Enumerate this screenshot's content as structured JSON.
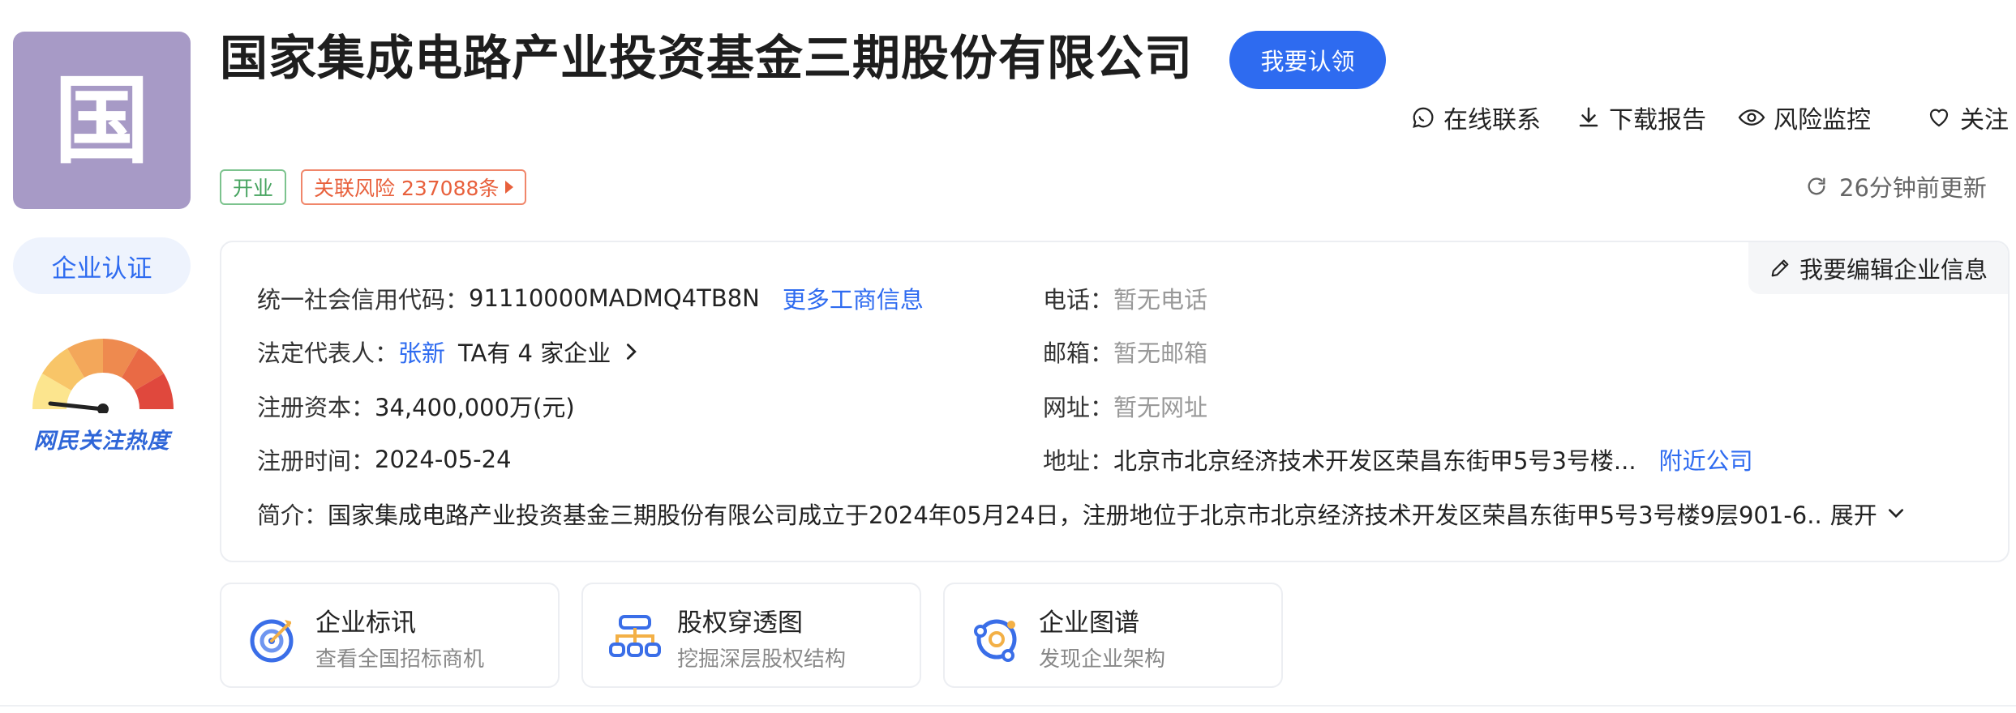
{
  "company": {
    "logo_char": "国",
    "name": "国家集成电路产业投资基金三期股份有限公司",
    "claim_label": "我要认领"
  },
  "actions": {
    "contact": "在线联系",
    "download": "下载报告",
    "monitor": "风险监控",
    "follow": "关注"
  },
  "tags": {
    "status": "开业",
    "risk": "关联风险 237088条"
  },
  "updated": "26分钟前更新",
  "sidebar": {
    "cert_label": "企业认证",
    "heat_label": "网民关注热度",
    "heat_level": 0.05
  },
  "info": {
    "edit_label": "我要编辑企业信息",
    "credit_code_label": "统一社会信用代码：",
    "credit_code": "91110000MADMQ4TB8N",
    "more_link": "更多工商信息",
    "legal_rep_label": "法定代表人：",
    "legal_rep": "张新",
    "legal_rep_companies": "TA有 4 家企业",
    "capital_label": "注册资本：",
    "capital": "34,400,000万(元)",
    "reg_date_label": "注册时间：",
    "reg_date": "2024-05-24",
    "phone_label": "电话：",
    "phone": "暂无电话",
    "email_label": "邮箱：",
    "email": "暂无邮箱",
    "website_label": "网址：",
    "website": "暂无网址",
    "address_label": "地址：",
    "address": "北京市北京经济技术开发区荣昌东街甲5号3号楼...",
    "nearby_link": "附近公司",
    "intro_label": "简介：",
    "intro": "国家集成电路产业投资基金三期股份有限公司成立于2024年05月24日，注册地位于北京市北京经济技术开发区荣昌东街甲5号3号楼9层901-6..",
    "expand": "展开"
  },
  "features": [
    {
      "title": "企业标讯",
      "subtitle": "查看全国招标商机",
      "icon": "target-icon"
    },
    {
      "title": "股权穿透图",
      "subtitle": "挖掘深层股权结构",
      "icon": "org-chart-icon"
    },
    {
      "title": "企业图谱",
      "subtitle": "发现企业架构",
      "icon": "graph-icon"
    }
  ],
  "colors": {
    "accent": "#2e6bf0",
    "logo_bg": "#a79ac6",
    "open_tag": "#46a35f",
    "risk_tag": "#e8603c"
  }
}
